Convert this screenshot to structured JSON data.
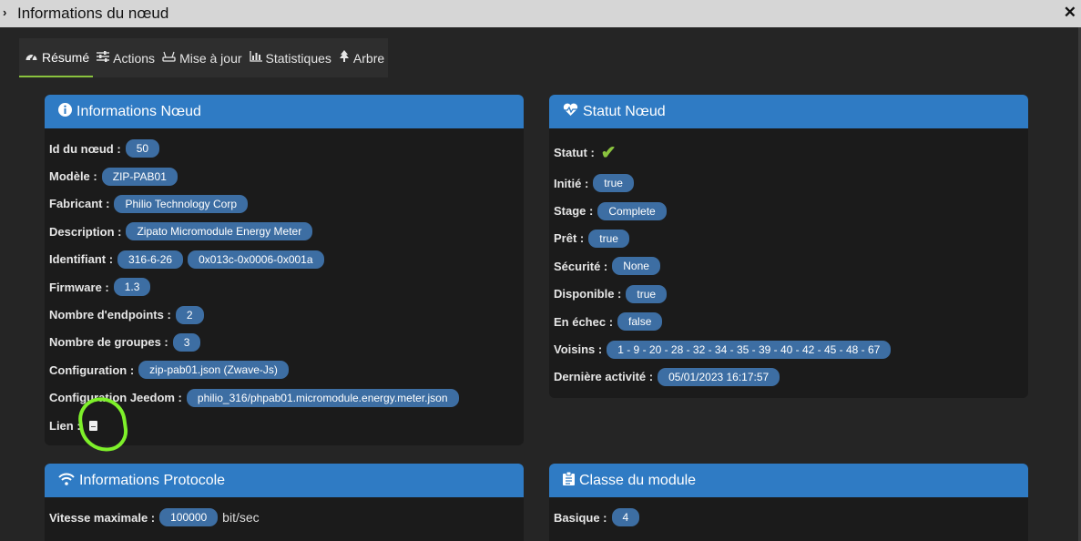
{
  "window": {
    "title": "Informations du nœud",
    "close_glyph": "✕",
    "chevron_glyph": "›"
  },
  "tabs": [
    {
      "label": "Résumé",
      "icon": "dashboard-icon",
      "active": true
    },
    {
      "label": "Actions",
      "icon": "sliders-icon"
    },
    {
      "label": "Mise à jour",
      "icon": "router-icon"
    },
    {
      "label": "Statistiques",
      "icon": "bar-chart-icon"
    },
    {
      "label": "Arbre",
      "icon": "tree-icon"
    }
  ],
  "node_info": {
    "title": "Informations Nœud",
    "node_id": {
      "label": "Id du nœud :",
      "value": "50"
    },
    "model": {
      "label": "Modèle :",
      "value": "ZIP-PAB01"
    },
    "manufacturer": {
      "label": "Fabricant :",
      "value": "Philio Technology Corp"
    },
    "description": {
      "label": "Description :",
      "value": "Zipato Micromodule Energy Meter"
    },
    "identifier": {
      "label": "Identifiant :",
      "values": [
        "316-6-26",
        "0x013c-0x0006-0x001a"
      ]
    },
    "firmware": {
      "label": "Firmware :",
      "value": "1.3"
    },
    "endpoints": {
      "label": "Nombre d'endpoints :",
      "value": "2"
    },
    "groups": {
      "label": "Nombre de groupes :",
      "value": "3"
    },
    "configuration": {
      "label": "Configuration :",
      "value": "zip-pab01.json (Zwave-Js)"
    },
    "jeedom_config": {
      "label": "Configuration Jeedom :",
      "value": "philio_316/phpab01.micromodule.energy.meter.json"
    },
    "link": {
      "label": "Lien :",
      "icon": "document-icon"
    }
  },
  "node_status": {
    "title": "Statut Nœud",
    "status": {
      "label": "Statut :",
      "icon": "checkmark-icon"
    },
    "initiated": {
      "label": "Initié :",
      "value": "true"
    },
    "stage": {
      "label": "Stage :",
      "value": "Complete"
    },
    "ready": {
      "label": "Prêt :",
      "value": "true"
    },
    "security": {
      "label": "Sécurité :",
      "value": "None"
    },
    "available": {
      "label": "Disponible :",
      "value": "true"
    },
    "failed": {
      "label": "En échec :",
      "value": "false"
    },
    "neighbors": {
      "label": "Voisins :",
      "value": "1 - 9 - 20 - 28 - 32 - 34 - 35 - 39 - 40 - 42 - 45 - 48 - 67"
    },
    "last_activity": {
      "label": "Dernière activité :",
      "value": "05/01/2023 16:17:57"
    }
  },
  "protocol_info": {
    "title": "Informations Protocole",
    "max_speed": {
      "label": "Vitesse maximale :",
      "value": "100000",
      "unit": "bit/sec"
    }
  },
  "module_class": {
    "title": "Classe du module",
    "basic": {
      "label": "Basique :",
      "value": "4"
    }
  },
  "colors": {
    "header_blue": "#2f7bc4",
    "badge_blue": "#3d6ea3",
    "accent_green": "#8ac33e",
    "highlight_green": "#7ef02a",
    "panel_bg": "#1b1b1b",
    "page_bg": "#252525"
  }
}
